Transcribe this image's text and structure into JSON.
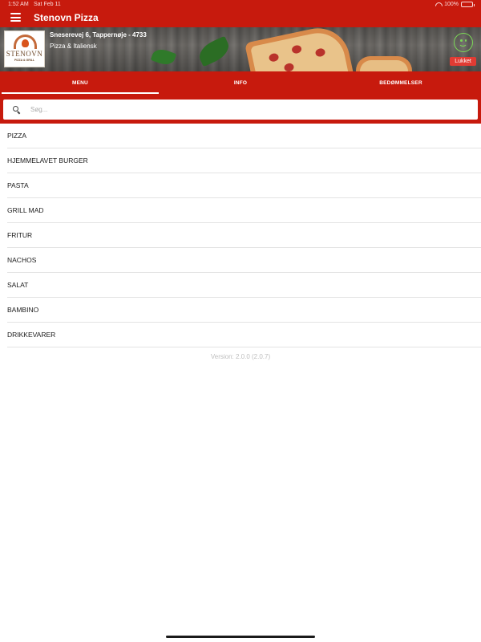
{
  "status_bar": {
    "time": "1:52 AM",
    "date": "Sat Feb 11",
    "battery": "100%",
    "battery_level": 1.0
  },
  "app_bar": {
    "title": "Stenovn Pizza",
    "menu_icon": "hamburger-menu-icon"
  },
  "restaurant": {
    "logo_name": "STENOVN",
    "logo_subtitle": "PIZZA & GRILL",
    "address": "Sneserevej 6, Tappernøje - 4733",
    "category": "Pizza & Italiensk",
    "status": "Lukket",
    "smiley_icon": "happy-smiley-icon"
  },
  "tabs": [
    {
      "label": "MENU",
      "active": true
    },
    {
      "label": "INFO",
      "active": false
    },
    {
      "label": "BEDØMMELSER",
      "active": false
    }
  ],
  "search": {
    "placeholder": "Søg...",
    "icon": "search-icon"
  },
  "menu_categories": [
    "PIZZA",
    "HJEMMELAVET BURGER",
    "PASTA",
    "GRILL MAD",
    "FRITUR",
    "NACHOS",
    "SALAT",
    "BAMBINO",
    "DRIKKEVARER"
  ],
  "version": "Version: 2.0.0 (2.0.7)",
  "colors": {
    "brand_red": "#c71a0d",
    "closed_badge": "#e23b33",
    "smiley_green": "#7bd657"
  }
}
